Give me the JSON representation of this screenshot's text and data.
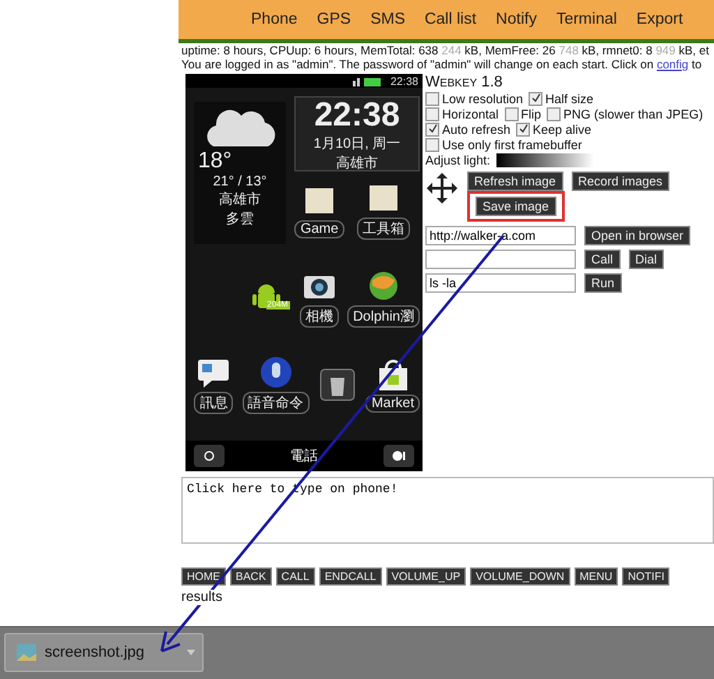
{
  "nav": {
    "items": [
      "Phone",
      "GPS",
      "SMS",
      "Call list",
      "Notify",
      "Terminal",
      "Export"
    ]
  },
  "status_line": [
    {
      "text": "uptime: 8 hours, CPUup: 6 hours, MemTotal: 638 ",
      "muted": false
    },
    {
      "text": "244",
      "muted": true
    },
    {
      "text": " kB, MemFree: 26 ",
      "muted": false
    },
    {
      "text": "748",
      "muted": true
    },
    {
      "text": " kB, rmnet0: 8 ",
      "muted": false
    },
    {
      "text": "949",
      "muted": true
    },
    {
      "text": " kB, et",
      "muted": false
    }
  ],
  "login_line": {
    "text": "You are logged in as \"admin\". The password of \"admin\" will change on each start. Click on ",
    "link": "config",
    "after": " to"
  },
  "phone": {
    "status_time": "22:38",
    "clock": {
      "time": "22:38",
      "date": "1月10日, 周一",
      "city": "高雄市"
    },
    "weather": {
      "temp": "18°",
      "range": "21° / 13°",
      "city": "高雄市",
      "condition": "多雲"
    },
    "folders": [
      {
        "label": "Game"
      },
      {
        "label": "工具箱"
      }
    ],
    "middle_apps": [
      {
        "kind": "android",
        "badge": "204M"
      },
      {
        "kind": "camera",
        "label": "相機"
      },
      {
        "kind": "globe",
        "label": "Dolphin瀏"
      }
    ],
    "dock_apps": [
      {
        "kind": "message",
        "label": "訊息"
      },
      {
        "kind": "mic",
        "label": "語音命令"
      },
      {
        "kind": "trash"
      },
      {
        "kind": "market",
        "label": "Market"
      }
    ],
    "call_label": "電話"
  },
  "panel": {
    "title": "Webkey 1.8",
    "option_rows": [
      [
        {
          "label": "Low resolution",
          "checked": false
        },
        {
          "label": "Half size",
          "checked": true
        }
      ],
      [
        {
          "label": "Horizontal",
          "checked": false
        },
        {
          "label": "Flip",
          "checked": false
        },
        {
          "label": "PNG (slower than JPEG)",
          "checked": false
        }
      ],
      [
        {
          "label": "Auto refresh",
          "checked": true
        },
        {
          "label": "Keep alive",
          "checked": true
        }
      ],
      [
        {
          "label": "Use only first framebuffer",
          "checked": false
        }
      ]
    ],
    "light_label": "Adjust light:",
    "image_buttons": [
      "Refresh image",
      "Record images"
    ],
    "save_button": "Save image",
    "url": {
      "value": "http://walker-a.com",
      "button": "Open in browser"
    },
    "phone_number": {
      "call_button": "Call",
      "dial_button": "Dial"
    },
    "command": {
      "value": "ls -la",
      "button": "Run"
    }
  },
  "typing_area": {
    "value": "Click here to type on phone!"
  },
  "keys": [
    "HOME",
    "BACK",
    "CALL",
    "ENDCALL",
    "VOLUME_UP",
    "VOLUME_DOWN",
    "MENU",
    "NOTIFI"
  ],
  "results_label": "results",
  "download": {
    "filename": "screenshot.jpg"
  }
}
